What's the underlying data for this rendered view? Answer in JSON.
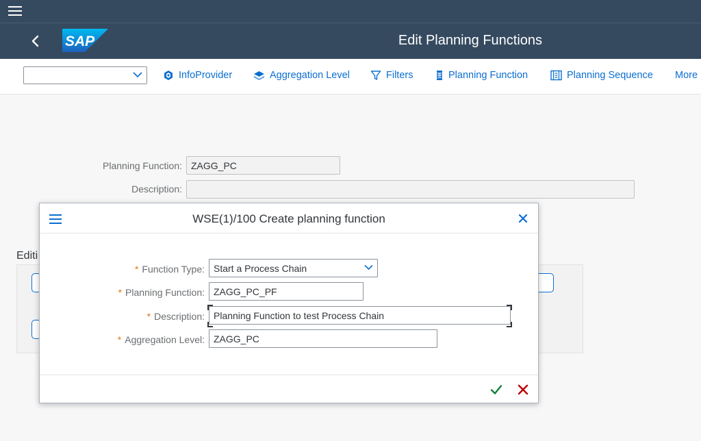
{
  "app": {
    "title": "Edit Planning Functions",
    "logo_text": "SAP",
    "accent_color": "#0a6ed1",
    "shell_color": "#354a5f"
  },
  "toolbar": {
    "select_value": "",
    "items": [
      {
        "label": "InfoProvider",
        "icon": "cube-icon"
      },
      {
        "label": "Aggregation Level",
        "icon": "stack-icon"
      },
      {
        "label": "Filters",
        "icon": "filter-icon"
      },
      {
        "label": "Planning Function",
        "icon": "function-icon"
      },
      {
        "label": "Planning Sequence",
        "icon": "sequence-icon"
      },
      {
        "label": "More",
        "icon": ""
      }
    ]
  },
  "main": {
    "planning_function_label": "Planning Function:",
    "planning_function_value": "ZAGG_PC",
    "description_label": "Description:",
    "description_value": "",
    "edit_heading": "Editi"
  },
  "dialog": {
    "title": "WSE(1)/100 Create planning function",
    "required_mark": "*",
    "fields": {
      "function_type_label": "Function Type:",
      "function_type_value": "Start a Process Chain",
      "planning_function_label": "Planning Function:",
      "planning_function_value": "ZAGG_PC_PF",
      "description_label": "Description:",
      "description_value": "Planning Function to test Process Chain",
      "aggregation_level_label": "Aggregation Level:",
      "aggregation_level_value": "ZAGG_PC"
    },
    "ok_color": "#107e3e",
    "cancel_color": "#bb0000"
  }
}
